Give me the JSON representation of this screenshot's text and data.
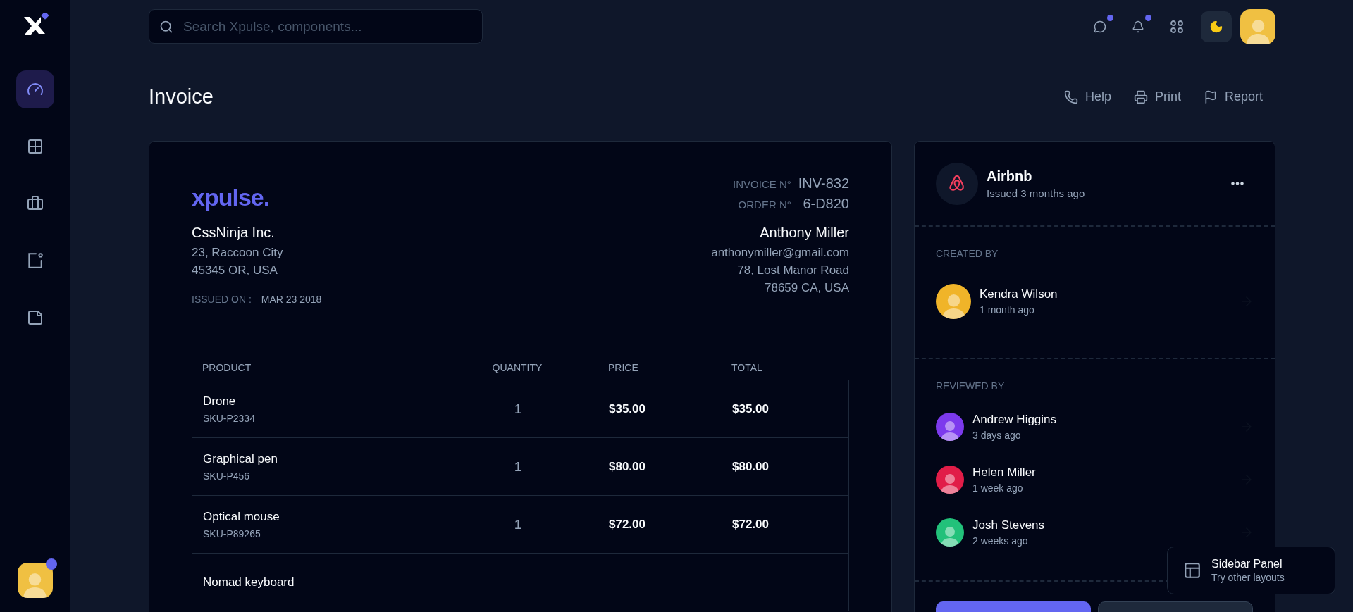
{
  "sidebar": {
    "items": [
      {
        "selected": true
      },
      {
        "selected": false
      },
      {
        "selected": false
      },
      {
        "selected": false
      },
      {
        "selected": false
      }
    ],
    "user": {
      "badge": true,
      "color": "#f0c042"
    }
  },
  "search": {
    "placeholder": "Search Xpulse, components..."
  },
  "topbar": {
    "buttons": [
      {
        "badge": true
      },
      {
        "badge": true
      },
      {
        "badge": false
      }
    ],
    "user": {
      "color": "#f0c042"
    }
  },
  "page": {
    "title": "Invoice",
    "actions": [
      "Help",
      "Print",
      "Report"
    ]
  },
  "invoice": {
    "logo": "xpulse.",
    "invoice_no_label": "INVOICE N°",
    "invoice_no": "INV-832",
    "order_no_label": "ORDER N°",
    "order_no": "6-D820",
    "from": {
      "name": "CssNinja Inc.",
      "lines": [
        "23, Raccoon City",
        "45345 OR, USA"
      ]
    },
    "to": {
      "name": "Anthony Miller",
      "lines": [
        "anthonymiller@gmail.com",
        "78, Lost Manor Road",
        "78659 CA, USA"
      ]
    },
    "issued_label": "ISSUED ON :",
    "issued_date": "MAR 23 2018",
    "table": {
      "columns": [
        "PRODUCT",
        "QUANTITY",
        "PRICE",
        "TOTAL"
      ],
      "rows": [
        {
          "product": "Drone",
          "sku": "SKU-P2334",
          "quantity": "1",
          "price": "$35.00",
          "total": "$35.00"
        },
        {
          "product": "Graphical pen",
          "sku": "SKU-P456",
          "quantity": "1",
          "price": "$80.00",
          "total": "$80.00"
        },
        {
          "product": "Optical mouse",
          "sku": "SKU-P89265",
          "quantity": "1",
          "price": "$72.00",
          "total": "$72.00"
        },
        {
          "product": "Nomad keyboard"
        }
      ]
    }
  },
  "details": {
    "company": "Airbnb",
    "issued": "Issued 3 months ago",
    "created_label": "CREATED BY",
    "created_by": [
      {
        "name": "Kendra Wilson",
        "time": "1 month ago",
        "color": "#f0b429"
      }
    ],
    "reviewed_label": "REVIEWED BY",
    "reviewed_by": [
      {
        "name": "Andrew Higgins",
        "time": "3 days ago",
        "color": "#7c3aed"
      },
      {
        "name": "Helen Miller",
        "time": "1 week ago",
        "color": "#e11d48"
      },
      {
        "name": "Josh Stevens",
        "time": "2 weeks ago",
        "color": "#22c17a"
      }
    ]
  },
  "layout_panel": {
    "title": "Sidebar Panel",
    "subtitle": "Try other layouts"
  }
}
